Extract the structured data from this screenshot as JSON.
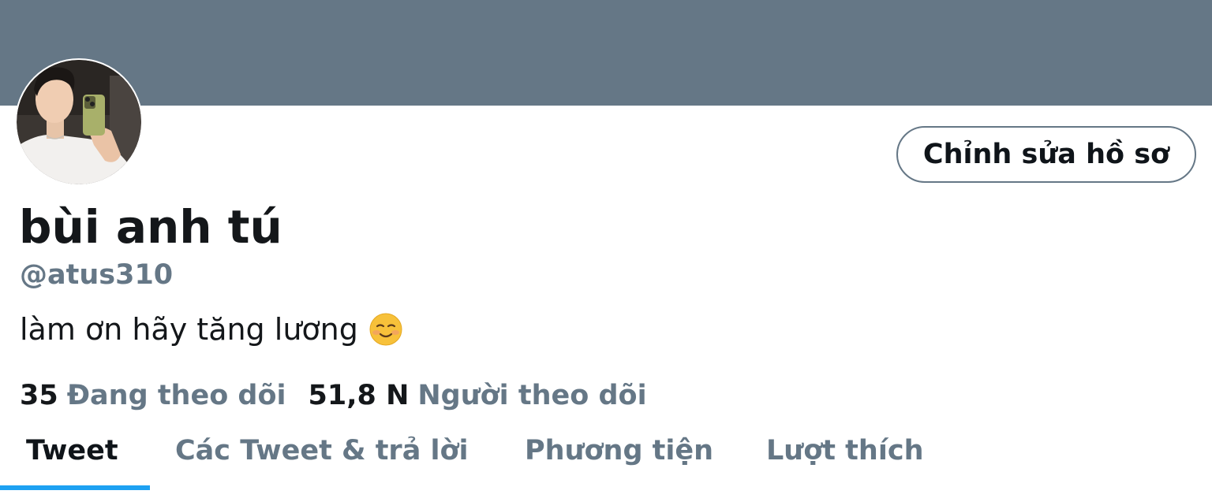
{
  "profile": {
    "display_name": "bùi anh tú",
    "handle": "@atus310",
    "bio": "làm ơn hãy tăng lương",
    "bio_emoji": "smiling-face-emoji",
    "avatar": "profile-photo"
  },
  "actions": {
    "edit_profile_label": "Chỉnh sửa hồ sơ"
  },
  "stats": {
    "following_count": "35",
    "following_label": "Đang theo dõi",
    "followers_count": "51,8 N",
    "followers_label": "Người theo dõi"
  },
  "tabs": [
    {
      "label": "Tweet",
      "active": true
    },
    {
      "label": "Các Tweet & trả lời",
      "active": false
    },
    {
      "label": "Phương tiện",
      "active": false
    },
    {
      "label": "Lượt thích",
      "active": false
    }
  ],
  "colors": {
    "banner": "#657786",
    "secondary_text": "#657786",
    "primary_text": "#14171a",
    "accent": "#1da1f2"
  }
}
